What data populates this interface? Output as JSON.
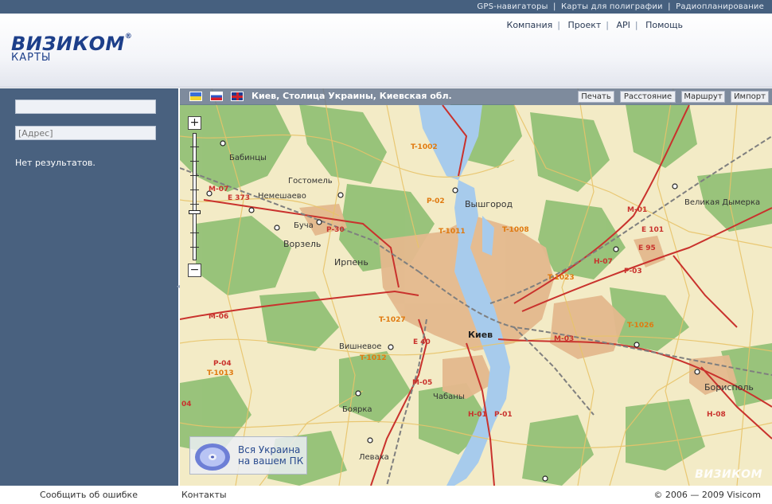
{
  "topbar": {
    "links": [
      "GPS-навигаторы",
      "Карты для полиграфии",
      "Радиопланирование"
    ]
  },
  "header": {
    "logo_brand": "ВИЗИКОМ",
    "logo_reg": "®",
    "logo_sub": "КАРТЫ",
    "nav": [
      "Компания",
      "Проект",
      "API",
      "Помощь"
    ]
  },
  "sidebar": {
    "search_value": "",
    "address_placeholder": "[Адрес]",
    "no_results": "Нет результатов."
  },
  "map": {
    "location": "Киев, Столица Украины, Киевская обл.",
    "buttons": {
      "print": "Печать",
      "distance": "Расстояние",
      "route": "Маршрут",
      "import": "Импорт"
    },
    "promo_line1": "Вся Украина",
    "promo_line2": "на вашем ПК",
    "watermark": "ВИЗИКОМ",
    "cities": {
      "kyiv": "Киев",
      "vyshgorod": "Вышгород",
      "irpin": "Ирпень",
      "vorzel": "Ворзель",
      "bucha": "Буча",
      "gostomel": "Гостомель",
      "nemeshaevo": "Немешаево",
      "babintsy": "Бабинцы",
      "vishnevoe": "Вишневое",
      "boyarka": "Боярка",
      "chabany": "Чабаны",
      "borispol": "Борисполь",
      "velikaya_dymerka": "Великая Дымерка",
      "levaha": "Леваха"
    },
    "roads": [
      "T-1002",
      "M-07",
      "E 373",
      "P-02",
      "T-1011",
      "T-1008",
      "P-30",
      "M-01",
      "E 101",
      "E 95",
      "H-07",
      "P-03",
      "T-1023",
      "T-1027",
      "E 40",
      "M-06",
      "T-1026",
      "M-03",
      "T-1012",
      "T-1013",
      "P-04",
      "M-05",
      "H-01",
      "P-01",
      "H-08",
      "04"
    ]
  },
  "footer": {
    "report": "Сообщить об ошибке",
    "contacts": "Контакты",
    "copyright": "© 2006 — 2009 Visicom"
  }
}
